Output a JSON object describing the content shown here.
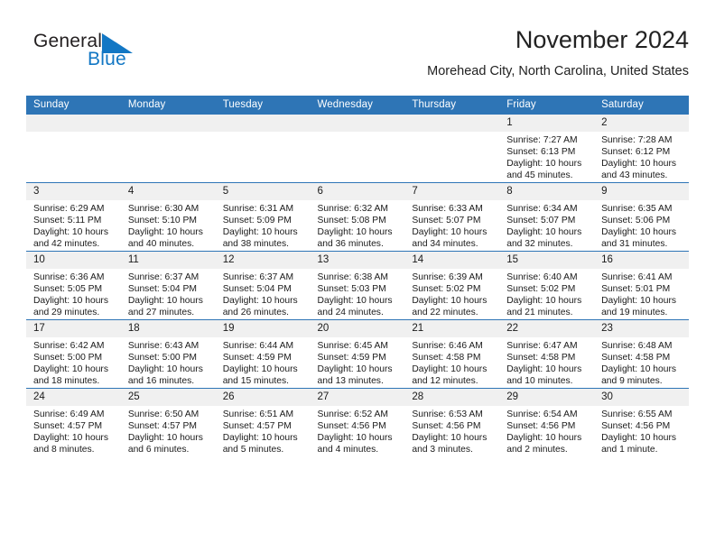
{
  "brand": {
    "name_part1": "General",
    "name_part2": "Blue",
    "triangle_color": "#1277c4",
    "icon": "triangle-logo"
  },
  "header": {
    "title": "November 2024",
    "subtitle": "Morehead City, North Carolina, United States"
  },
  "colors": {
    "header_band": "#2e75b6",
    "daynum_band": "#f0f0f0",
    "text": "#1a1a1a",
    "brand_blue": "#1277c4"
  },
  "weekday_headers": [
    "Sunday",
    "Monday",
    "Tuesday",
    "Wednesday",
    "Thursday",
    "Friday",
    "Saturday"
  ],
  "weeks": [
    [
      {
        "day": "",
        "empty": true
      },
      {
        "day": "",
        "empty": true
      },
      {
        "day": "",
        "empty": true
      },
      {
        "day": "",
        "empty": true
      },
      {
        "day": "",
        "empty": true
      },
      {
        "day": "1",
        "sunrise": "Sunrise: 7:27 AM",
        "sunset": "Sunset: 6:13 PM",
        "daylight1": "Daylight: 10 hours",
        "daylight2": "and 45 minutes."
      },
      {
        "day": "2",
        "sunrise": "Sunrise: 7:28 AM",
        "sunset": "Sunset: 6:12 PM",
        "daylight1": "Daylight: 10 hours",
        "daylight2": "and 43 minutes."
      }
    ],
    [
      {
        "day": "3",
        "sunrise": "Sunrise: 6:29 AM",
        "sunset": "Sunset: 5:11 PM",
        "daylight1": "Daylight: 10 hours",
        "daylight2": "and 42 minutes."
      },
      {
        "day": "4",
        "sunrise": "Sunrise: 6:30 AM",
        "sunset": "Sunset: 5:10 PM",
        "daylight1": "Daylight: 10 hours",
        "daylight2": "and 40 minutes."
      },
      {
        "day": "5",
        "sunrise": "Sunrise: 6:31 AM",
        "sunset": "Sunset: 5:09 PM",
        "daylight1": "Daylight: 10 hours",
        "daylight2": "and 38 minutes."
      },
      {
        "day": "6",
        "sunrise": "Sunrise: 6:32 AM",
        "sunset": "Sunset: 5:08 PM",
        "daylight1": "Daylight: 10 hours",
        "daylight2": "and 36 minutes."
      },
      {
        "day": "7",
        "sunrise": "Sunrise: 6:33 AM",
        "sunset": "Sunset: 5:07 PM",
        "daylight1": "Daylight: 10 hours",
        "daylight2": "and 34 minutes."
      },
      {
        "day": "8",
        "sunrise": "Sunrise: 6:34 AM",
        "sunset": "Sunset: 5:07 PM",
        "daylight1": "Daylight: 10 hours",
        "daylight2": "and 32 minutes."
      },
      {
        "day": "9",
        "sunrise": "Sunrise: 6:35 AM",
        "sunset": "Sunset: 5:06 PM",
        "daylight1": "Daylight: 10 hours",
        "daylight2": "and 31 minutes."
      }
    ],
    [
      {
        "day": "10",
        "sunrise": "Sunrise: 6:36 AM",
        "sunset": "Sunset: 5:05 PM",
        "daylight1": "Daylight: 10 hours",
        "daylight2": "and 29 minutes."
      },
      {
        "day": "11",
        "sunrise": "Sunrise: 6:37 AM",
        "sunset": "Sunset: 5:04 PM",
        "daylight1": "Daylight: 10 hours",
        "daylight2": "and 27 minutes."
      },
      {
        "day": "12",
        "sunrise": "Sunrise: 6:37 AM",
        "sunset": "Sunset: 5:04 PM",
        "daylight1": "Daylight: 10 hours",
        "daylight2": "and 26 minutes."
      },
      {
        "day": "13",
        "sunrise": "Sunrise: 6:38 AM",
        "sunset": "Sunset: 5:03 PM",
        "daylight1": "Daylight: 10 hours",
        "daylight2": "and 24 minutes."
      },
      {
        "day": "14",
        "sunrise": "Sunrise: 6:39 AM",
        "sunset": "Sunset: 5:02 PM",
        "daylight1": "Daylight: 10 hours",
        "daylight2": "and 22 minutes."
      },
      {
        "day": "15",
        "sunrise": "Sunrise: 6:40 AM",
        "sunset": "Sunset: 5:02 PM",
        "daylight1": "Daylight: 10 hours",
        "daylight2": "and 21 minutes."
      },
      {
        "day": "16",
        "sunrise": "Sunrise: 6:41 AM",
        "sunset": "Sunset: 5:01 PM",
        "daylight1": "Daylight: 10 hours",
        "daylight2": "and 19 minutes."
      }
    ],
    [
      {
        "day": "17",
        "sunrise": "Sunrise: 6:42 AM",
        "sunset": "Sunset: 5:00 PM",
        "daylight1": "Daylight: 10 hours",
        "daylight2": "and 18 minutes."
      },
      {
        "day": "18",
        "sunrise": "Sunrise: 6:43 AM",
        "sunset": "Sunset: 5:00 PM",
        "daylight1": "Daylight: 10 hours",
        "daylight2": "and 16 minutes."
      },
      {
        "day": "19",
        "sunrise": "Sunrise: 6:44 AM",
        "sunset": "Sunset: 4:59 PM",
        "daylight1": "Daylight: 10 hours",
        "daylight2": "and 15 minutes."
      },
      {
        "day": "20",
        "sunrise": "Sunrise: 6:45 AM",
        "sunset": "Sunset: 4:59 PM",
        "daylight1": "Daylight: 10 hours",
        "daylight2": "and 13 minutes."
      },
      {
        "day": "21",
        "sunrise": "Sunrise: 6:46 AM",
        "sunset": "Sunset: 4:58 PM",
        "daylight1": "Daylight: 10 hours",
        "daylight2": "and 12 minutes."
      },
      {
        "day": "22",
        "sunrise": "Sunrise: 6:47 AM",
        "sunset": "Sunset: 4:58 PM",
        "daylight1": "Daylight: 10 hours",
        "daylight2": "and 10 minutes."
      },
      {
        "day": "23",
        "sunrise": "Sunrise: 6:48 AM",
        "sunset": "Sunset: 4:58 PM",
        "daylight1": "Daylight: 10 hours",
        "daylight2": "and 9 minutes."
      }
    ],
    [
      {
        "day": "24",
        "sunrise": "Sunrise: 6:49 AM",
        "sunset": "Sunset: 4:57 PM",
        "daylight1": "Daylight: 10 hours",
        "daylight2": "and 8 minutes."
      },
      {
        "day": "25",
        "sunrise": "Sunrise: 6:50 AM",
        "sunset": "Sunset: 4:57 PM",
        "daylight1": "Daylight: 10 hours",
        "daylight2": "and 6 minutes."
      },
      {
        "day": "26",
        "sunrise": "Sunrise: 6:51 AM",
        "sunset": "Sunset: 4:57 PM",
        "daylight1": "Daylight: 10 hours",
        "daylight2": "and 5 minutes."
      },
      {
        "day": "27",
        "sunrise": "Sunrise: 6:52 AM",
        "sunset": "Sunset: 4:56 PM",
        "daylight1": "Daylight: 10 hours",
        "daylight2": "and 4 minutes."
      },
      {
        "day": "28",
        "sunrise": "Sunrise: 6:53 AM",
        "sunset": "Sunset: 4:56 PM",
        "daylight1": "Daylight: 10 hours",
        "daylight2": "and 3 minutes."
      },
      {
        "day": "29",
        "sunrise": "Sunrise: 6:54 AM",
        "sunset": "Sunset: 4:56 PM",
        "daylight1": "Daylight: 10 hours",
        "daylight2": "and 2 minutes."
      },
      {
        "day": "30",
        "sunrise": "Sunrise: 6:55 AM",
        "sunset": "Sunset: 4:56 PM",
        "daylight1": "Daylight: 10 hours",
        "daylight2": "and 1 minute."
      }
    ]
  ]
}
